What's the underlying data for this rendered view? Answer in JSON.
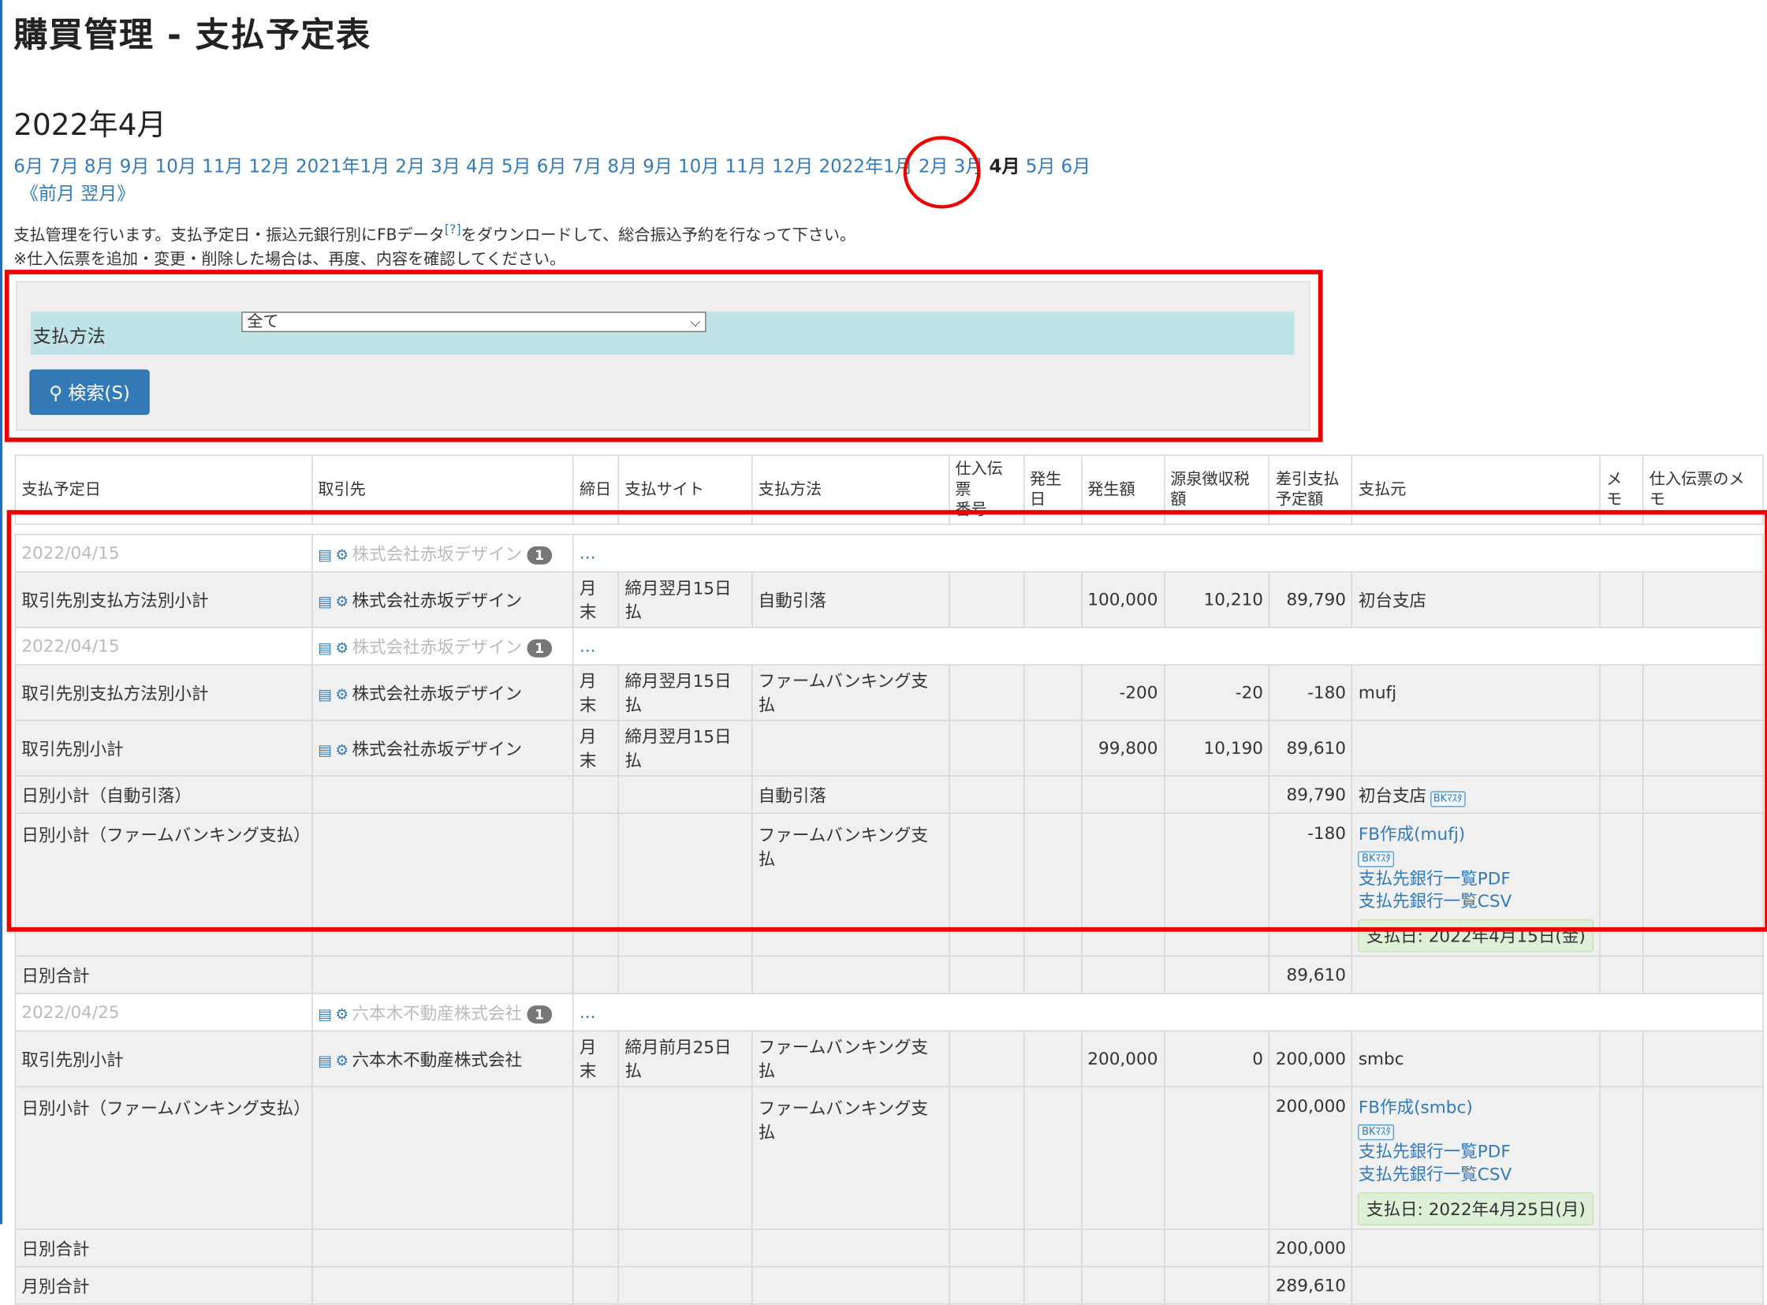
{
  "title": "購買管理 - 支払予定表",
  "month_heading": "2022年4月",
  "month_nav": [
    "6月",
    "7月",
    "8月",
    "9月",
    "10月",
    "11月",
    "12月",
    "2021年1月",
    "2月",
    "3月",
    "4月",
    "5月",
    "6月",
    "7月",
    "8月",
    "9月",
    "10月",
    "11月",
    "12月",
    "2022年1月",
    "2月",
    "3月",
    "4月",
    "5月",
    "6月"
  ],
  "month_nav_current_index": 22,
  "prev_month": "前月",
  "next_month": "翌月",
  "prevnext_open": "《",
  "prevnext_close": "》",
  "desc_line1a": "支払管理を行います。支払予定日・振込元銀行別にFBデータ",
  "desc_help": "[?]",
  "desc_line1b": "をダウンロードして、総合振込予約を行なって下さい。",
  "desc_line2": "※仕入伝票を追加・変更・削除した場合は、再度、内容を確認してください。",
  "filter": {
    "label": "支払方法",
    "selected": "全て"
  },
  "search_button": "検索(S)",
  "headers": [
    "支払予定日",
    "取引先",
    "締日",
    "支払サイト",
    "支払方法",
    "仕入伝票番号",
    "発生日",
    "発生額",
    "源泉徴収税額",
    "差引支払予定額",
    "支払元",
    "メモ",
    "仕入伝票のメモ"
  ],
  "header_split": {
    "slip_no_1": "仕入伝票",
    "slip_no_2": "番号",
    "net_1": "差引支払",
    "net_2": "予定額"
  },
  "rows": {
    "r1": {
      "date": "2022/04/15",
      "vendor": "株式会社赤坂デザイン",
      "badge": "1",
      "more": "..."
    },
    "r2": {
      "label": "取引先別支払方法別小計",
      "vendor": "株式会社赤坂デザイン",
      "closing": "月末",
      "site": "締月翌月15日払",
      "method": "自動引落",
      "amount": "100,000",
      "tax": "10,210",
      "net": "89,790",
      "source": "初台支店"
    },
    "r3": {
      "date": "2022/04/15",
      "vendor": "株式会社赤坂デザイン",
      "badge": "1",
      "more": "..."
    },
    "r4": {
      "label": "取引先別支払方法別小計",
      "vendor": "株式会社赤坂デザイン",
      "closing": "月末",
      "site": "締月翌月15日払",
      "method": "ファームバンキング支払",
      "amount": "-200",
      "tax": "-20",
      "net": "-180",
      "source": "mufj"
    },
    "r5": {
      "label": "取引先別小計",
      "vendor": "株式会社赤坂デザイン",
      "closing": "月末",
      "site": "締月翌月15日払",
      "amount": "99,800",
      "tax": "10,190",
      "net": "89,610"
    },
    "r6": {
      "label": "日別小計（自動引落）",
      "method": "自動引落",
      "net": "89,790",
      "source": "初台支店",
      "bk": "BKﾏｽﾀ"
    },
    "r7": {
      "label": "日別小計（ファームバンキング支払）",
      "method": "ファームバンキング支払",
      "net": "-180",
      "fb": "FB作成(mufj)",
      "bk": "BKﾏｽﾀ",
      "pdf": "支払先銀行一覧PDF",
      "csv": "支払先銀行一覧CSV",
      "paydate": "支払日: 2022年4月15日(金)"
    },
    "r8": {
      "label": "日別合計",
      "net": "89,610"
    },
    "r9": {
      "date": "2022/04/25",
      "vendor": "六本木不動産株式会社",
      "badge": "1",
      "more": "..."
    },
    "r10": {
      "label": "取引先別小計",
      "vendor": "六本木不動産株式会社",
      "closing": "月末",
      "site": "締月前月25日払",
      "method": "ファームバンキング支払",
      "amount": "200,000",
      "tax": "0",
      "net": "200,000",
      "source": "smbc"
    },
    "r11": {
      "label": "日別小計（ファームバンキング支払）",
      "method": "ファームバンキング支払",
      "net": "200,000",
      "fb": "FB作成(smbc)",
      "bk": "BKﾏｽﾀ",
      "pdf": "支払先銀行一覧PDF",
      "csv": "支払先銀行一覧CSV",
      "paydate": "支払日: 2022年4月25日(月)"
    },
    "r12": {
      "label": "日別合計",
      "net": "200,000"
    },
    "r13": {
      "label": "月別合計",
      "net": "289,610"
    }
  }
}
